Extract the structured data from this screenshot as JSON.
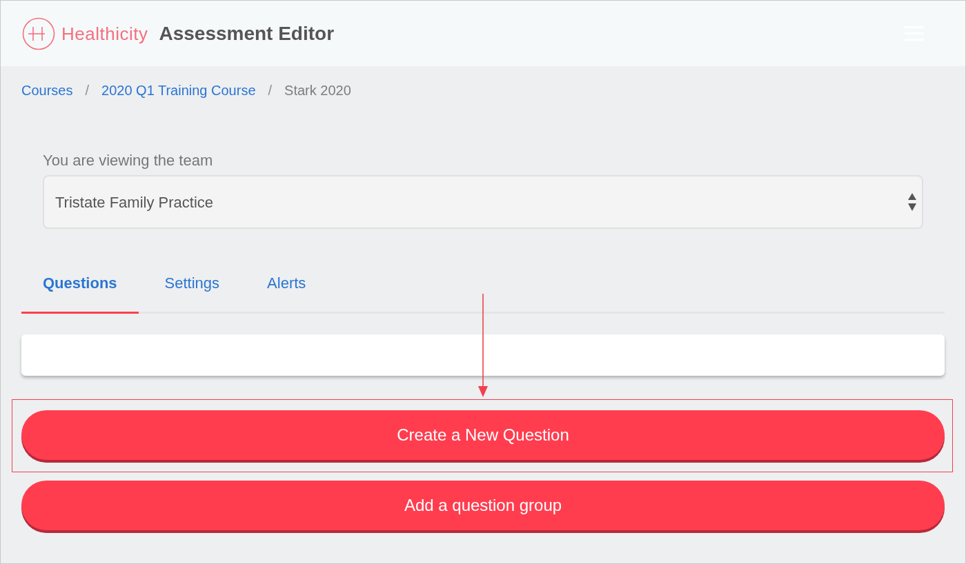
{
  "header": {
    "brand": "Healthicity",
    "title": "Assessment Editor"
  },
  "breadcrumbs": [
    {
      "label": "Courses",
      "current": false
    },
    {
      "separator": "/",
      "label": "2020 Q1 Training Course",
      "current": false
    },
    {
      "separator": "/",
      "label": "Stark 2020",
      "current": true
    }
  ],
  "team_select": {
    "label": "You are viewing the team",
    "value": "Tristate Family Practice"
  },
  "tabs": [
    {
      "label": "Questions",
      "selected": true
    },
    {
      "label": "Settings",
      "selected": false
    },
    {
      "label": "Alerts",
      "selected": false
    }
  ],
  "buttons": [
    {
      "label": "Create a New Question",
      "highlighted": true
    },
    {
      "label": "Add a question group",
      "highlighted": false
    }
  ]
}
